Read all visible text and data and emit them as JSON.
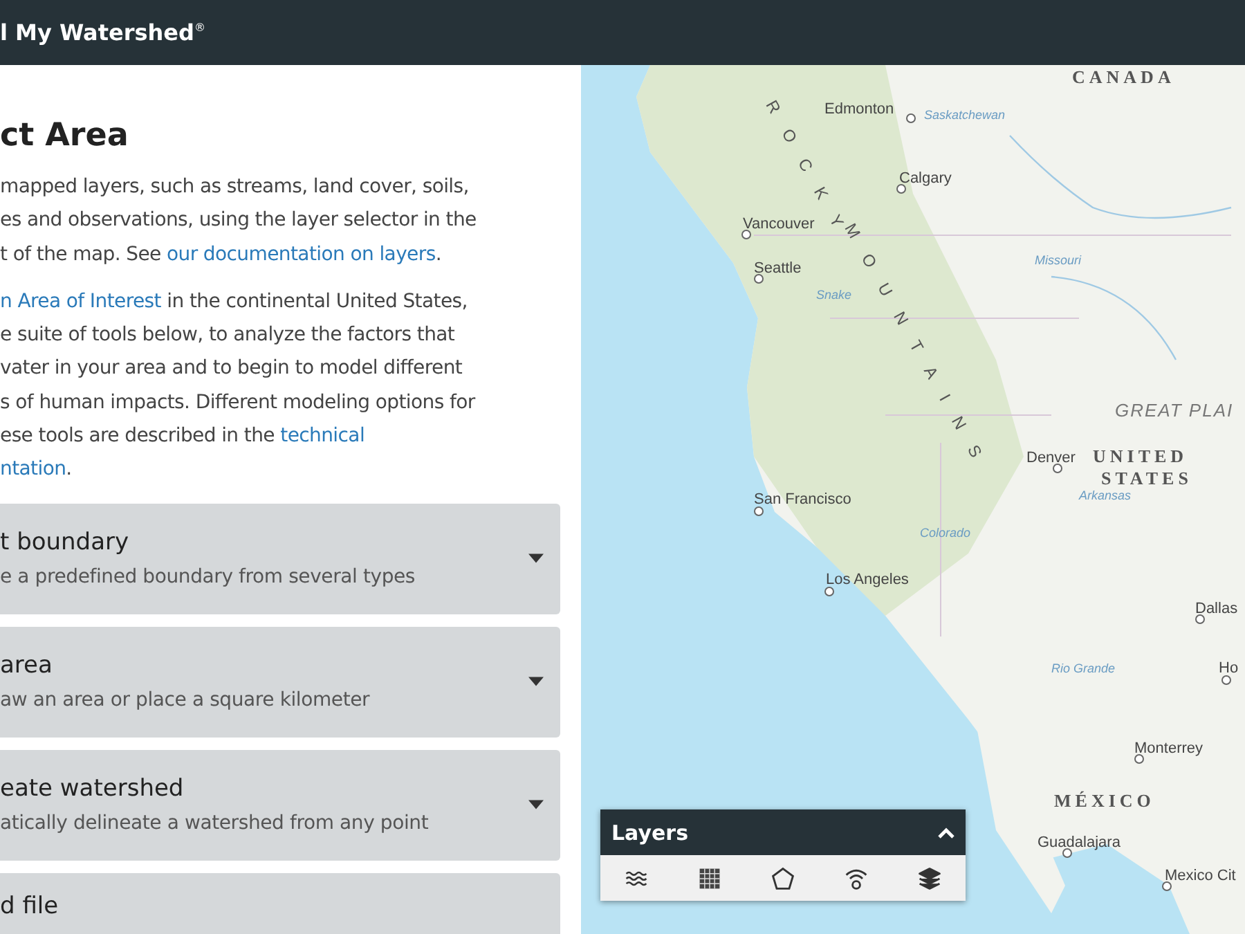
{
  "header": {
    "brand": "l My Watershed",
    "brand_mark": "®"
  },
  "panel": {
    "title": "ct Area",
    "paragraphs": [
      [
        [
          {
            "text": "mapped layers, such as streams, land cover, soils,",
            "link": false
          }
        ],
        [
          {
            "text": "es and observations, using the layer selector in the",
            "link": false
          }
        ],
        [
          {
            "text": "t of the map. See ",
            "link": false
          },
          {
            "text": "our documentation on layers",
            "link": true
          },
          {
            "text": ".",
            "link": false
          }
        ]
      ],
      [
        [
          {
            "text": "n Area of Interest",
            "link": true
          },
          {
            "text": " in the continental United States,",
            "link": false
          }
        ],
        [
          {
            "text": "e suite of tools below, to analyze the factors that",
            "link": false
          }
        ],
        [
          {
            "text": "vater in your area and to begin to model different",
            "link": false
          }
        ],
        [
          {
            "text": "s of human impacts. Different modeling options for",
            "link": false
          }
        ],
        [
          {
            "text": "ese tools are described in the ",
            "link": false
          },
          {
            "text": "technical",
            "link": true
          }
        ],
        [
          {
            "text": "ntation",
            "link": true
          },
          {
            "text": ".",
            "link": false
          }
        ]
      ]
    ],
    "options": [
      {
        "title": "t boundary",
        "subtitle": "e a predefined boundary from several types",
        "expanded": false
      },
      {
        "title": "area",
        "subtitle": "aw an area or place a square kilometer",
        "expanded": false
      },
      {
        "title": "eate watershed",
        "subtitle": "atically delineate a watershed from any point",
        "expanded": false
      },
      {
        "title": "d file"
      }
    ]
  },
  "map": {
    "labels": [
      {
        "text": "CANADA",
        "kind": "country"
      },
      {
        "text": "Edmonton",
        "kind": "city"
      },
      {
        "text": "Saskatchewan",
        "kind": "river"
      },
      {
        "text": "Calgary",
        "kind": "city"
      },
      {
        "text": "Vancouver",
        "kind": "city"
      },
      {
        "text": "Seattle",
        "kind": "city"
      },
      {
        "text": "Missouri",
        "kind": "river"
      },
      {
        "text": "Snake",
        "kind": "river"
      },
      {
        "text": "GREAT PLAI",
        "kind": "region"
      },
      {
        "text": "Denver",
        "kind": "city"
      },
      {
        "text": "UNITED",
        "kind": "country"
      },
      {
        "text": "STATES",
        "kind": "country"
      },
      {
        "text": "Arkansas",
        "kind": "river"
      },
      {
        "text": "San Francisco",
        "kind": "city"
      },
      {
        "text": "Colorado",
        "kind": "river"
      },
      {
        "text": "Los Angeles",
        "kind": "city"
      },
      {
        "text": "Dallas",
        "kind": "city"
      },
      {
        "text": "Rio Grande",
        "kind": "river"
      },
      {
        "text": "Ho",
        "kind": "city"
      },
      {
        "text": "Monterrey",
        "kind": "city"
      },
      {
        "text": "MÉXICO",
        "kind": "country"
      },
      {
        "text": "Guadalajara",
        "kind": "city"
      },
      {
        "text": "Mexico Cit",
        "kind": "city"
      }
    ],
    "mountain_label": [
      "ROCKY",
      "MOUNTAINS"
    ],
    "layers": {
      "title": "Layers",
      "expanded": true
    }
  }
}
